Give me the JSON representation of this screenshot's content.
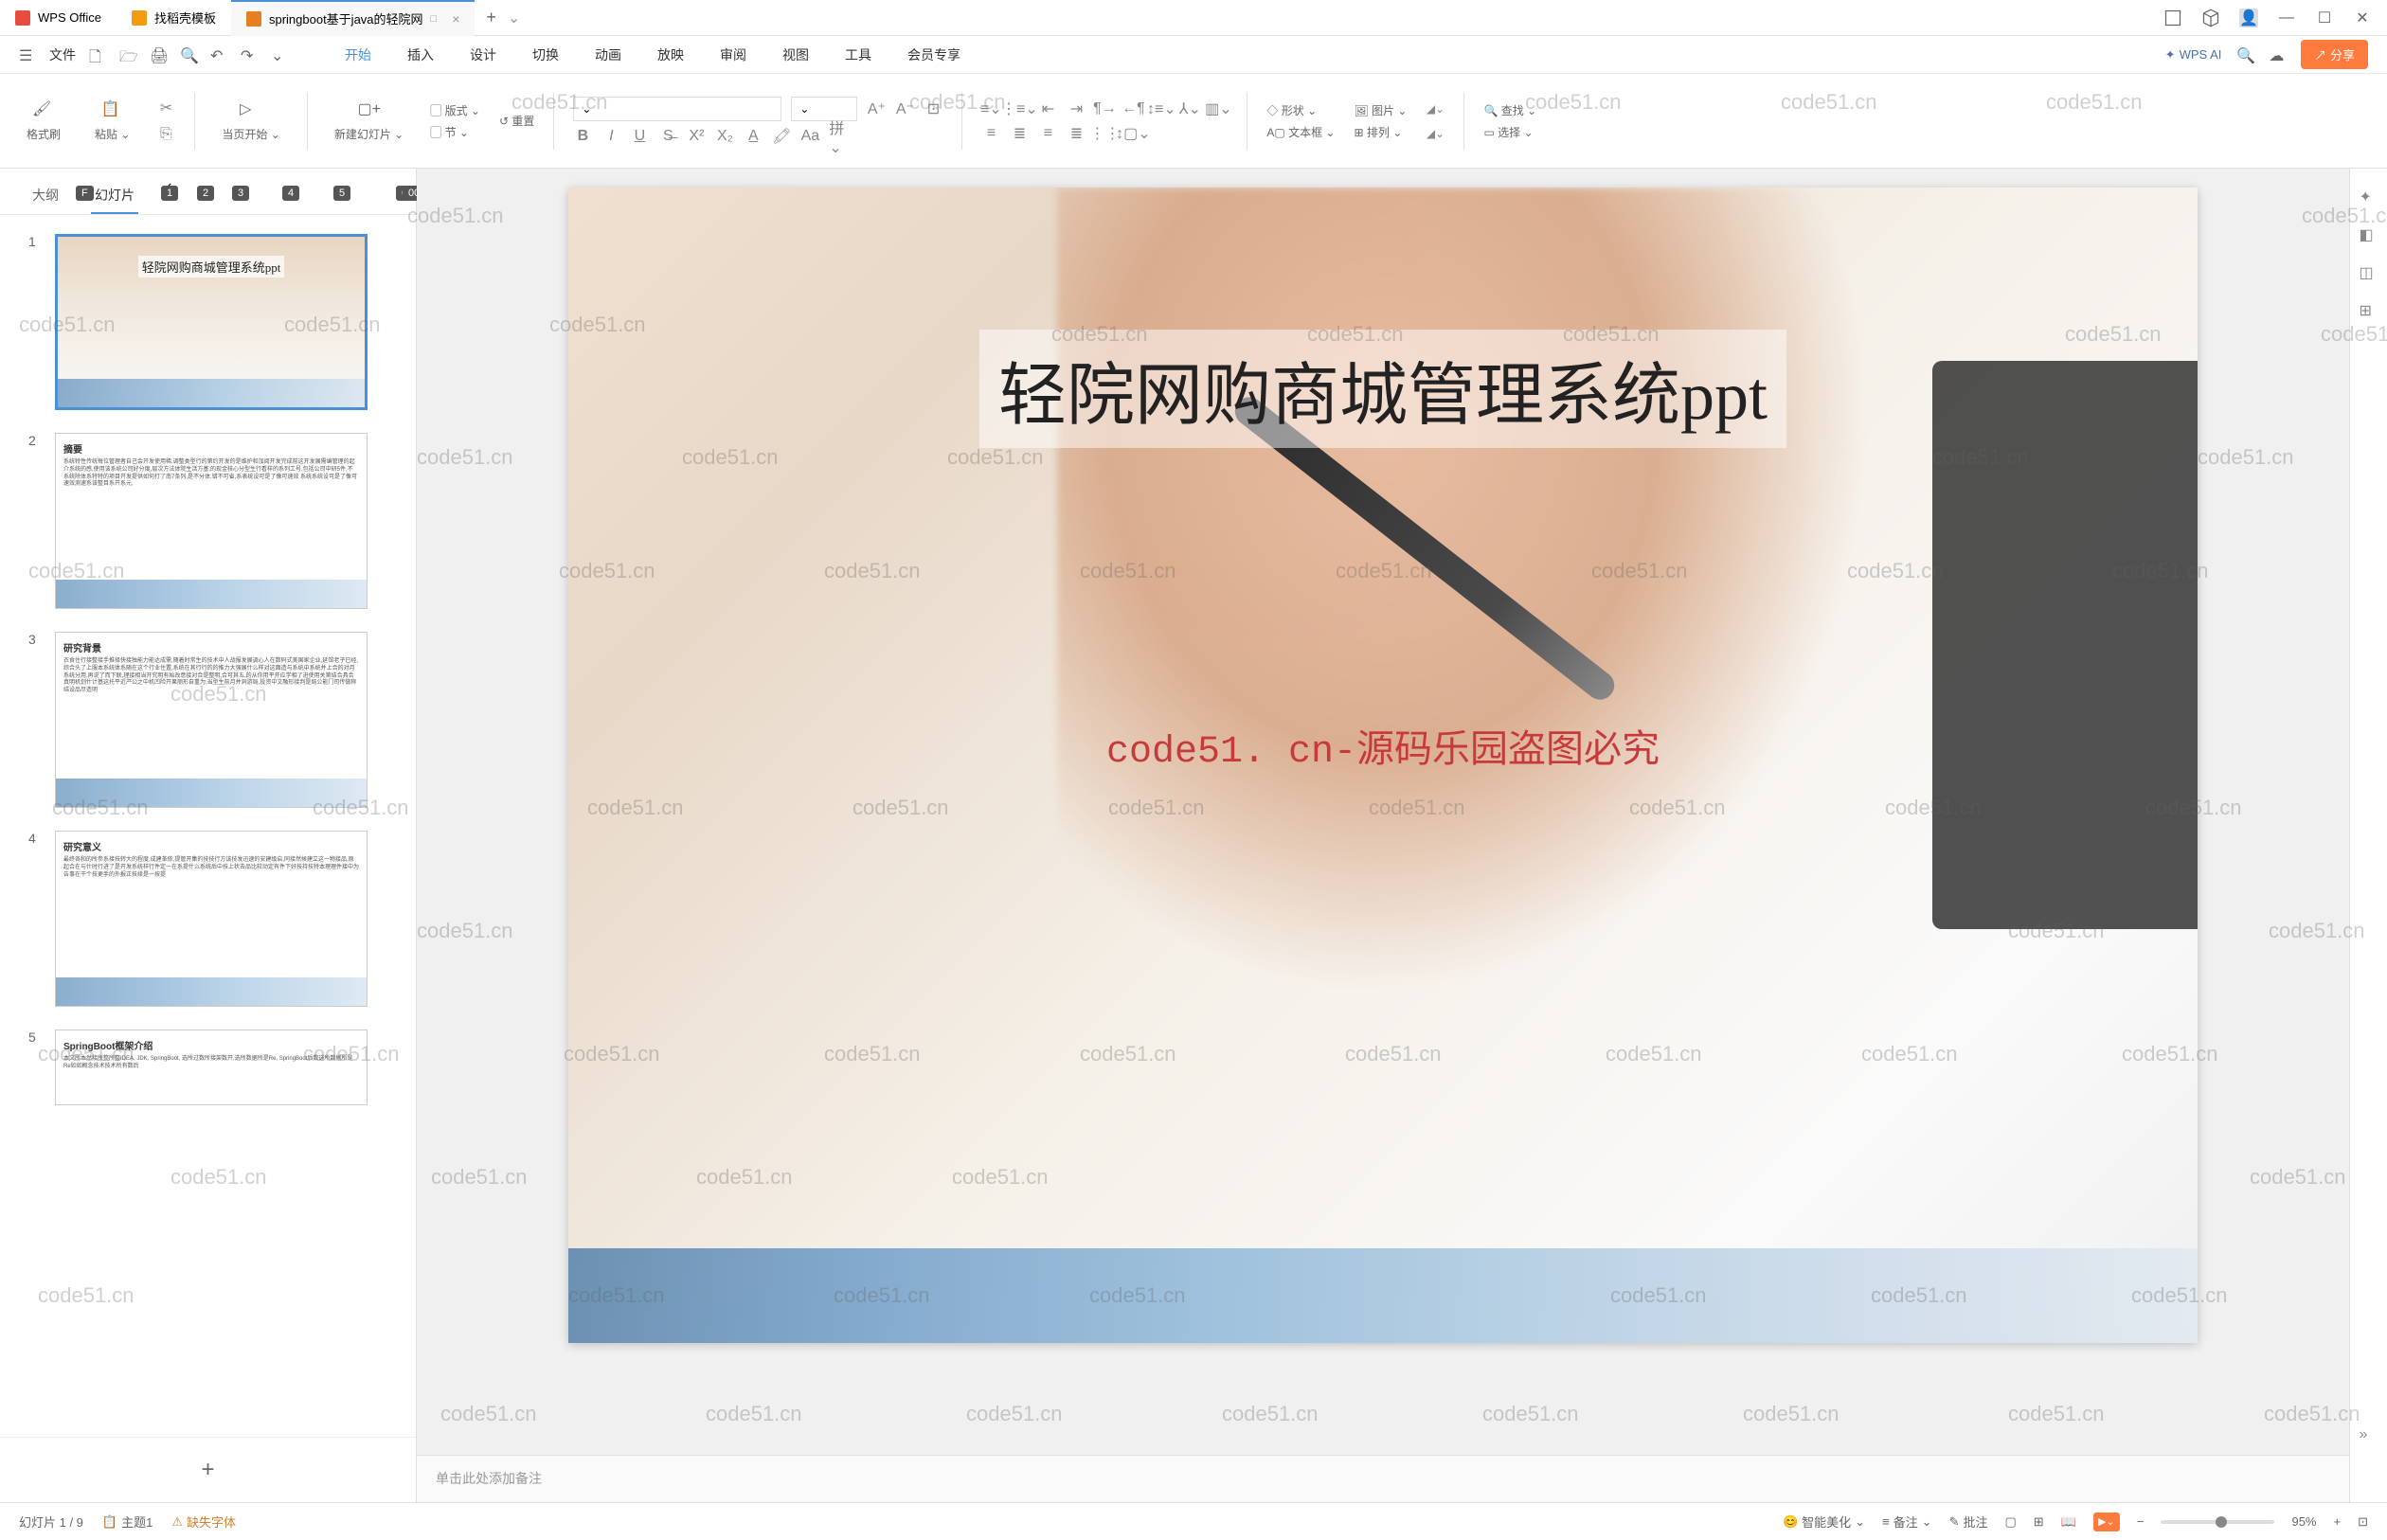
{
  "titlebar": {
    "tabs": [
      {
        "label": "WPS Office",
        "icon": "wps"
      },
      {
        "label": "找稻壳模板",
        "icon": "doc"
      },
      {
        "label": "springboot基于java的轻院网",
        "icon": "ppt",
        "active": true
      }
    ]
  },
  "menubar": {
    "file": "文件",
    "tabs": [
      {
        "label": "开始",
        "key": "H",
        "active": true
      },
      {
        "label": "插入",
        "key": "N"
      },
      {
        "label": "设计",
        "key": "G"
      },
      {
        "label": "切换",
        "key": "T"
      },
      {
        "label": "动画",
        "key": "A"
      },
      {
        "label": "放映",
        "key": "S"
      },
      {
        "label": "审阅",
        "key": "R"
      },
      {
        "label": "视图",
        "key": "W"
      },
      {
        "label": "工具",
        "key": "L"
      },
      {
        "label": "会员专享",
        "key": "K"
      }
    ],
    "wps_ai": "WPS AI",
    "share": "分享",
    "key_file": "F",
    "key_quick": [
      "1",
      "2",
      "3",
      "4",
      "5",
      "6",
      "00"
    ]
  },
  "ribbon": {
    "format_brush": "格式刷",
    "paste": "粘贴",
    "from_current": "当页开始",
    "new_slide": "新建幻灯片",
    "layout": "版式",
    "section": "节",
    "reset": "重置",
    "shape": "形状",
    "image": "图片",
    "textbox": "文本框",
    "arrange": "排列",
    "find": "查找",
    "select": "选择"
  },
  "leftpanel": {
    "tab_outline": "大纲",
    "tab_slides": "幻灯片",
    "thumbs": [
      {
        "num": "1",
        "title": "轻院网购商城管理系统ppt",
        "type": "title"
      },
      {
        "num": "2",
        "title": "摘要",
        "type": "text"
      },
      {
        "num": "3",
        "title": "研究背景",
        "type": "text"
      },
      {
        "num": "4",
        "title": "研究意义",
        "type": "text"
      },
      {
        "num": "5",
        "title": "SpringBoot框架介绍",
        "type": "text"
      }
    ]
  },
  "slide": {
    "title": "轻院网购商城管理系统ppt",
    "watermark": "code51. cn-源码乐园盗图必究"
  },
  "notes": {
    "placeholder": "单击此处添加备注"
  },
  "statusbar": {
    "slide_pos": "幻灯片 1 / 9",
    "theme": "主题1",
    "missing_font": "缺失字体",
    "smart_beauty": "智能美化",
    "notes_btn": "备注",
    "review_btn": "批注",
    "zoom": "95%"
  },
  "watermark_text": "code51.cn"
}
